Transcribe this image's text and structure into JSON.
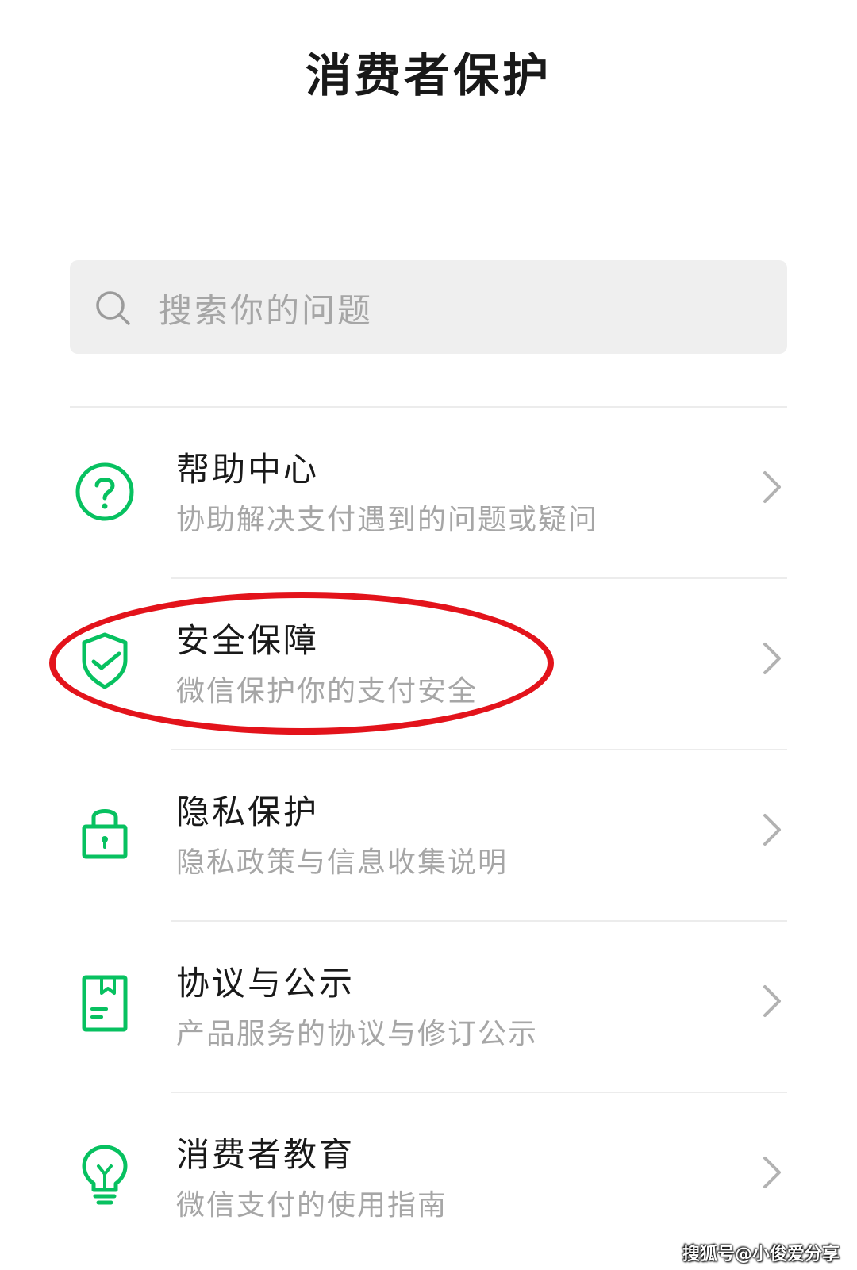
{
  "header": {
    "title": "消费者保护"
  },
  "search": {
    "placeholder": "搜索你的问题"
  },
  "menu": {
    "items": [
      {
        "title": "帮助中心",
        "desc": "协助解决支付遇到的问题或疑问",
        "icon": "help-circle-icon"
      },
      {
        "title": "安全保障",
        "desc": "微信保护你的支付安全",
        "icon": "shield-check-icon"
      },
      {
        "title": "隐私保护",
        "desc": "隐私政策与信息收集说明",
        "icon": "lock-icon"
      },
      {
        "title": "协议与公示",
        "desc": "产品服务的协议与修订公示",
        "icon": "document-icon"
      },
      {
        "title": "消费者教育",
        "desc": "微信支付的使用指南",
        "icon": "lightbulb-icon"
      }
    ]
  },
  "colors": {
    "accent_green": "#07c160",
    "highlight_red": "#e3131b",
    "text_primary": "#191919",
    "text_secondary": "#a6a6a6"
  },
  "watermark": {
    "text": "搜狐号@小俊爱分享"
  }
}
